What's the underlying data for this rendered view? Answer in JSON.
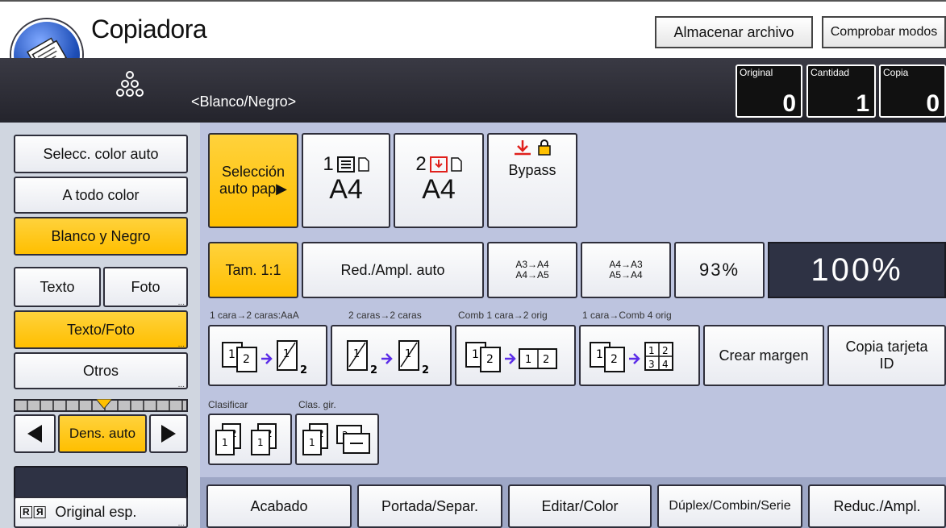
{
  "app": {
    "title": "Copiadora"
  },
  "toolbar": {
    "store_file": "Almacenar archivo",
    "check_modes": "Comprobar modos"
  },
  "header": {
    "mode": "<Blanco/Negro>"
  },
  "counters": {
    "original": {
      "label": "Original",
      "value": "0"
    },
    "quantity": {
      "label": "Cantidad",
      "value": "1"
    },
    "copies": {
      "label": "Copia",
      "value": "0"
    }
  },
  "color": {
    "auto": "Selecc. color auto",
    "full": "A todo color",
    "bw": "Blanco y Negro"
  },
  "original_type": {
    "text": "Texto",
    "photo": "Foto",
    "text_photo": "Texto/Foto",
    "other": "Otros"
  },
  "density": {
    "label": "Dens. auto",
    "level_fraction": 0.5
  },
  "special_original": {
    "label": "Original esp."
  },
  "paper": {
    "auto": "Selección auto pap▶",
    "tray1": {
      "number": "1",
      "size": "A4"
    },
    "tray2": {
      "number": "2",
      "size": "A4"
    },
    "bypass": "Bypass"
  },
  "reduce": {
    "full_size": "Tam. 1:1",
    "auto": "Red./Ampl. auto",
    "preset1": [
      "A3→A4",
      "A4→A5"
    ],
    "preset2": [
      "A4→A3",
      "A5→A4"
    ],
    "ratio": "93%",
    "current": "100%"
  },
  "duplex": {
    "label1": "1 cara→2 caras:AaA",
    "label2": "2 caras→2 caras",
    "label3": "Comb 1 cara→2 orig",
    "label4": "1 cara→Comb 4 orig",
    "margin": "Crear margen",
    "id_card": "Copia tarjeta ID"
  },
  "sort": {
    "sort_label": "Clasificar",
    "rotate_label": "Clas. gir."
  },
  "tabs": [
    "Acabado",
    "Portada/Separ.",
    "Editar/Color",
    "Dúplex/Combin/Serie",
    "Reduc./Ampl."
  ],
  "colors": {
    "selected": "#ffc000",
    "dark_header": "#2a2a32",
    "panel": "#bdc4df"
  }
}
